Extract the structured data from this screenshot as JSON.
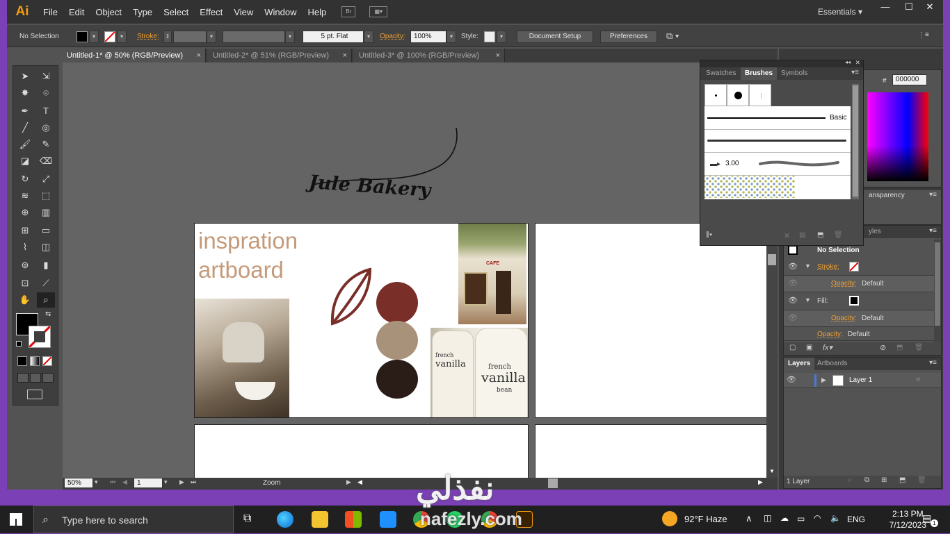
{
  "app": {
    "logo": "Ai",
    "menus": [
      "File",
      "Edit",
      "Object",
      "Type",
      "Select",
      "Effect",
      "View",
      "Window",
      "Help"
    ],
    "bridge": "Br",
    "workspace": "Essentials",
    "accent": "#f39c12"
  },
  "control": {
    "selection": "No Selection",
    "stroke_label": "Stroke:",
    "brush": "5 pt. Flat",
    "opacity_label": "Opacity:",
    "opacity": "100%",
    "style_label": "Style:",
    "doc_setup": "Document Setup",
    "preferences": "Preferences"
  },
  "tabs": [
    {
      "label": "Untitled-1* @ 50% (RGB/Preview)"
    },
    {
      "label": "Untitled-2* @ 51% (RGB/Preview)"
    },
    {
      "label": "Untitled-3* @ 100% (RGB/Preview)"
    }
  ],
  "tab_close": "×",
  "canvas": {
    "logo_text": "Jule Bakery",
    "headline1": "inspration",
    "headline2": "artboard",
    "jar_text1": "french",
    "jar_text2": "vanilla",
    "jar_text3": "bean",
    "shop_sign": "CAFE",
    "swatches": [
      "#7a2e28",
      "#a8927a",
      "#2a1d18"
    ]
  },
  "brushes_panel": {
    "tabs": [
      "Swatches",
      "Brushes",
      "Symbols"
    ],
    "basic": "Basic",
    "size": "3.00"
  },
  "color_panel": {
    "hex_label": "#",
    "hex": "000000"
  },
  "transparency_panel": {
    "label": "ansparency"
  },
  "appearance_panel": {
    "tab": "yles",
    "title": "No Selection",
    "stroke": "Stroke:",
    "opacity": "Opacity:",
    "default": "Default",
    "fill": "Fill:"
  },
  "layers_panel": {
    "tabs": [
      "Layers",
      "Artboards"
    ],
    "layer": "Layer 1",
    "footer": "1 Layer"
  },
  "status": {
    "zoom": "50%",
    "page": "1",
    "mode": "Zoom"
  },
  "taskbar": {
    "search": "Type here to search",
    "weather": "92°F  Haze",
    "lang": "ENG",
    "time": "2:13 PM",
    "date": "7/12/2023",
    "notif": "1"
  },
  "watermark": {
    "arabic": "نفذلي",
    "latin": "nafezly.com"
  }
}
